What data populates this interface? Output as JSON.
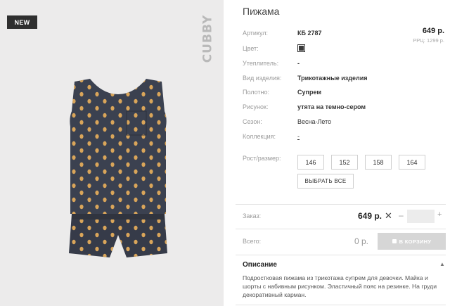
{
  "badge": "NEW",
  "brand": "CUBBY",
  "product": {
    "title": "Пижама",
    "price": "649 р.",
    "rrp": "РРЦ: 1299 р."
  },
  "specs": [
    {
      "label": "Артикул:",
      "value": "КБ 2787"
    },
    {
      "label": "Цвет:",
      "value": ""
    },
    {
      "label": "Утеплитель:",
      "value": "-"
    },
    {
      "label": "Вид изделия:",
      "value": "Трикотажные изделия"
    },
    {
      "label": "Полотно:",
      "value": "Супрем"
    },
    {
      "label": "Рисунок:",
      "value": "утята на темно-сером"
    },
    {
      "label": "Сезон:",
      "value": "Весна-Лето"
    },
    {
      "label": "Коллекция:",
      "value": "-"
    }
  ],
  "color_swatch": "#3a3a3a",
  "size_label": "Рост/размер:",
  "sizes": [
    "146",
    "152",
    "158",
    "164"
  ],
  "select_all": "ВЫБРАТЬ ВСЕ",
  "order": {
    "label": "Заказ:",
    "price": "649 р.",
    "remove_icon": "close-icon",
    "minus": "–",
    "plus": "+"
  },
  "total": {
    "label": "Всего:",
    "value": "0 р.",
    "cart_button": "В КОРЗИНУ"
  },
  "description": {
    "heading": "Описание",
    "text": "Подростковая пижама из трикотажа супрем для девочки. Майка и шорты с набивным рисунком. Эластичный пояс на резинке. На груди декоративный карман."
  },
  "colors": {
    "garment": "#3b4150",
    "print": "#d9a55a",
    "background": "#ecebeb"
  }
}
